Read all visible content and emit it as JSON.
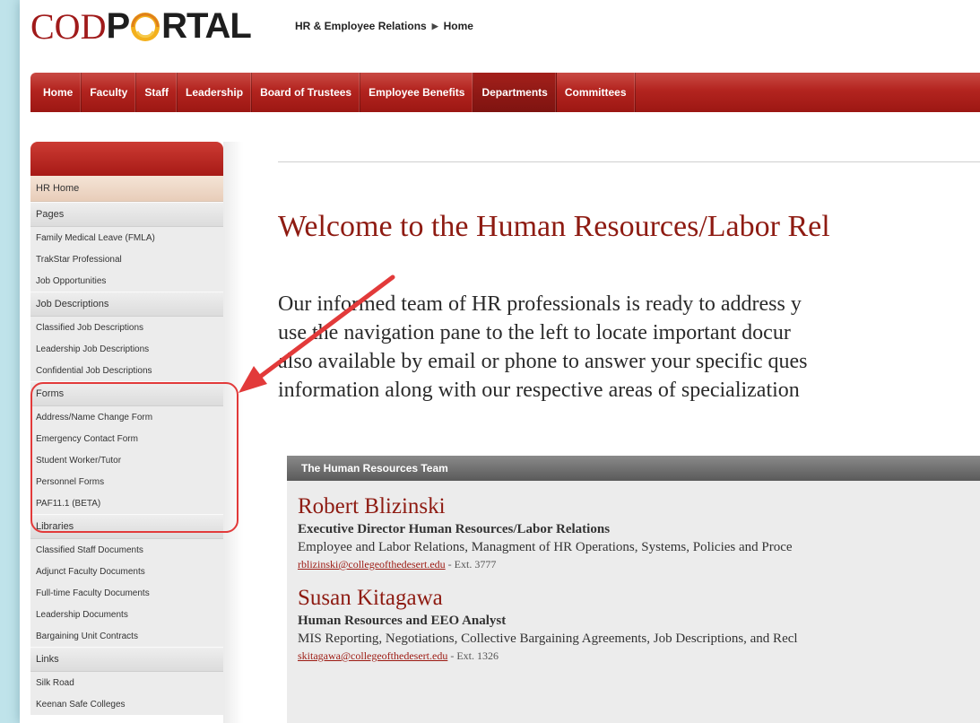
{
  "header": {
    "logo_cod": "COD",
    "logo_p": "P",
    "logo_rtal": "RTAL",
    "breadcrumb": [
      "HR & Employee Relations",
      "Home"
    ]
  },
  "nav": {
    "items": [
      "Home",
      "Faculty",
      "Staff",
      "Leadership",
      "Board of Trustees",
      "Employee Benefits",
      "Departments",
      "Committees"
    ],
    "active": "Departments"
  },
  "sidebar": {
    "home": "HR Home",
    "sections": [
      {
        "title": "Pages",
        "links": [
          "Family Medical Leave (FMLA)",
          "TrakStar Professional",
          "Job Opportunities"
        ]
      },
      {
        "title": "Job Descriptions",
        "links": [
          "Classified Job Descriptions",
          "Leadership Job Descriptions",
          "Confidential Job Descriptions"
        ]
      },
      {
        "title": "Forms",
        "links": [
          "Address/Name Change Form",
          "Emergency Contact Form",
          "Student Worker/Tutor",
          "Personnel Forms",
          "PAF11.1 (BETA)"
        ]
      },
      {
        "title": "Libraries",
        "links": [
          "Classified Staff Documents",
          "Adjunct Faculty Documents",
          "Full-time Faculty Documents",
          "Leadership Documents",
          "Bargaining Unit Contracts"
        ]
      },
      {
        "title": "Links",
        "links": [
          "Silk Road",
          "Keenan Safe Colleges"
        ]
      }
    ]
  },
  "main": {
    "welcome": "Welcome to the Human Resources/Labor Rel",
    "intro_lines": [
      "Our informed team of HR professionals is ready to address y",
      "use the navigation pane to the left to locate important docur",
      "also available by email or phone to answer your specific ques",
      "information along with our respective areas of specialization"
    ],
    "team": {
      "header": "The Human Resources Team",
      "members": [
        {
          "name": "Robert Blizinski",
          "title": "Executive Director Human Resources/Labor Relations",
          "desc": "Employee and Labor Relations, Managment of HR Operations, Systems, Policies and Proce",
          "email": "rblizinski@collegeofthedesert.edu",
          "ext": " - Ext. 3777"
        },
        {
          "name": "Susan Kitagawa",
          "title": "Human Resources and EEO Analyst",
          "desc": "MIS Reporting, Negotiations, Collective Bargaining Agreements, Job Descriptions, and Recl",
          "email": "skitagawa@collegeofthedesert.edu",
          "ext": " - Ext. 1326"
        }
      ]
    }
  },
  "colors": {
    "brand_red": "#a01a1a",
    "annotation_red": "#e23a3a",
    "page_bg": "#bfe3ea"
  }
}
